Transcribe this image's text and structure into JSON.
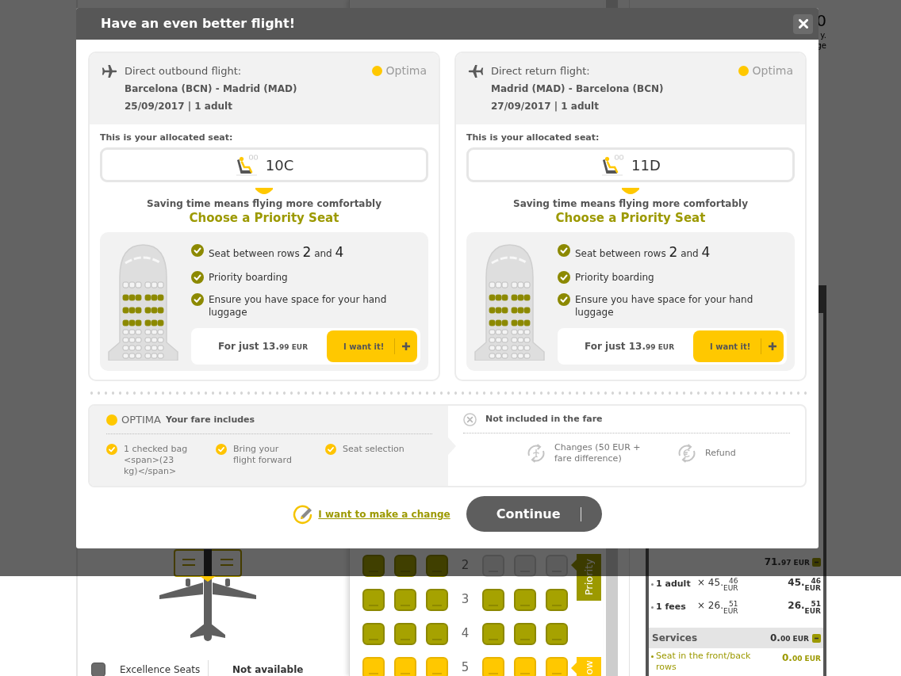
{
  "modal": {
    "title": "Have an even better flight!",
    "flights": [
      {
        "kind": "outbound",
        "heading": "Direct outbound flight:",
        "route": "Barcelona (BCN) - Madrid (MAD)",
        "details": "25/09/2017 | 1 adult",
        "fare": "Optima",
        "seat_caption": "This is your allocated seat:",
        "seat": "10C",
        "pitch": "Saving time means flying more comfortably",
        "offer_title": "Choose a Priority Seat",
        "benefits": [
          {
            "kind": "rows",
            "text": "Seat between rows",
            "from": "2",
            "joiner": "and",
            "to": "4"
          },
          {
            "kind": "plain",
            "text": "Priority boarding"
          },
          {
            "kind": "plain",
            "text": "Ensure you have space for your hand luggage"
          }
        ],
        "price": {
          "lead": "For just 13.",
          "cents": "99",
          "currency": "EUR"
        },
        "cta": "I want it!"
      },
      {
        "kind": "return",
        "heading": "Direct return flight:",
        "route": "Madrid (MAD) - Barcelona (BCN)",
        "details": "27/09/2017 | 1 adult",
        "fare": "Optima",
        "seat_caption": "This is your allocated seat:",
        "seat": "11D",
        "pitch": "Saving time means flying more comfortably",
        "offer_title": "Choose a Priority Seat",
        "benefits": [
          {
            "kind": "rows",
            "text": "Seat between rows",
            "from": "2",
            "joiner": "and",
            "to": "4"
          },
          {
            "kind": "plain",
            "text": "Priority boarding"
          },
          {
            "kind": "plain",
            "text": "Ensure you have space for your hand luggage"
          }
        ],
        "price": {
          "lead": "For just 13.",
          "cents": "99",
          "currency": "EUR"
        },
        "cta": "I want it!"
      }
    ],
    "fare": {
      "name": "OPTIMA",
      "includes_title": "Your fare includes",
      "included": [
        "1 checked bag <span>(23 kg)</span>",
        "Bring your flight forward",
        "Seat selection"
      ],
      "excludes_title": "Not included in the fare",
      "excluded": [
        {
          "kind": "changes",
          "text": "Changes (50 EUR + fare difference)"
        },
        {
          "kind": "refund",
          "text": "Refund"
        }
      ]
    },
    "change_link": "I want to make a change",
    "continue": "Continue"
  },
  "background": {
    "header_fragment": "0",
    "note_fragments": [
      "y.",
      "ge"
    ],
    "legend": {
      "label": "Excellence Seats",
      "status": "Not available"
    },
    "seat_rows": [
      {
        "number": "2",
        "left": [
          {
            "kind": "priority"
          },
          {
            "kind": "priority"
          },
          {
            "kind": "priority"
          }
        ],
        "right": [
          {
            "kind": "unavailable"
          },
          {
            "kind": "unavailable"
          },
          {
            "kind": "unavailable"
          }
        ]
      },
      {
        "number": "3",
        "left": [
          {
            "kind": "priority"
          },
          {
            "kind": "priority"
          },
          {
            "kind": "priority"
          }
        ],
        "right": [
          {
            "kind": "priority"
          },
          {
            "kind": "priority"
          },
          {
            "kind": "priority"
          }
        ]
      },
      {
        "number": "4",
        "left": [
          {
            "kind": "priority"
          },
          {
            "kind": "priority"
          },
          {
            "kind": "priority"
          }
        ],
        "right": [
          {
            "kind": "priority"
          },
          {
            "kind": "priority"
          },
          {
            "kind": "priority"
          }
        ]
      },
      {
        "number": "5",
        "left": [
          {
            "kind": "standard"
          },
          {
            "kind": "standard"
          },
          {
            "kind": "standard"
          }
        ],
        "right": [
          {
            "kind": "standard"
          },
          {
            "kind": "standard"
          },
          {
            "kind": "standard"
          }
        ]
      }
    ],
    "zones": [
      {
        "kind": "priority",
        "label": "Priority"
      },
      {
        "kind": "standard",
        "label": "ow"
      }
    ],
    "summary": {
      "total": {
        "amount": {
          "whole": "71.",
          "cents": "97",
          "currency": "EUR"
        },
        "expanded": true
      },
      "lines": [
        {
          "label": "1 adult",
          "unit": {
            "whole": "× 45.",
            "cents": "46",
            "currency": "EUR"
          },
          "total": {
            "whole": "45.",
            "cents": "46",
            "currency": "EUR"
          }
        },
        {
          "label": "1 fees",
          "unit": {
            "whole": "× 26.",
            "cents": "51",
            "currency": "EUR"
          },
          "total": {
            "whole": "26.",
            "cents": "51",
            "currency": "EUR"
          }
        }
      ],
      "services": {
        "label": "Services",
        "amount": {
          "whole": "0.",
          "cents": "00",
          "currency": "EUR"
        },
        "expanded": true,
        "items": [
          {
            "label": "Seat in the front/back rows",
            "amount": {
              "whole": "0.",
              "cents": "00",
              "currency": "EUR"
            }
          }
        ]
      }
    }
  }
}
